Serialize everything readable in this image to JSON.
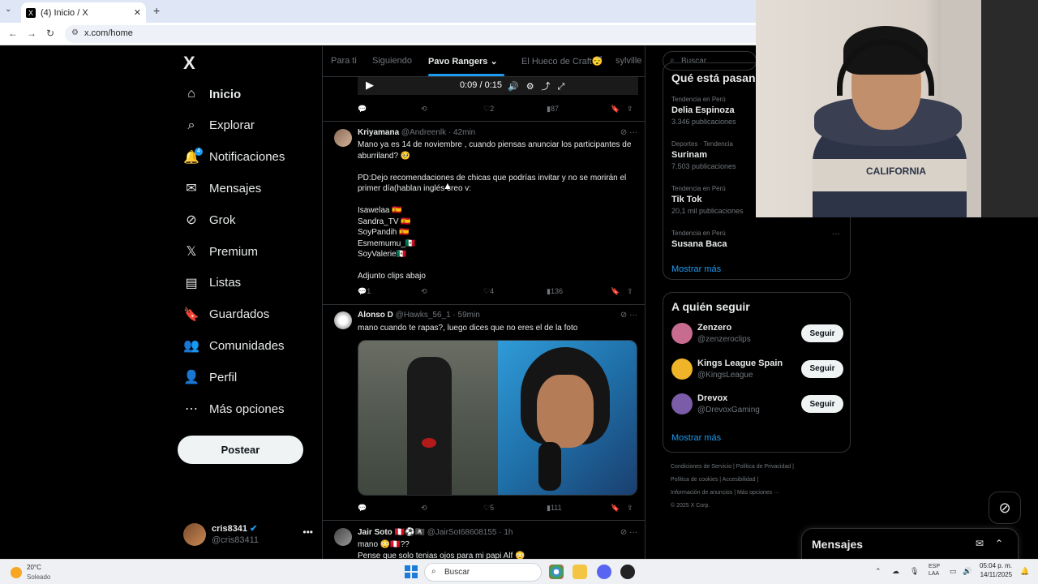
{
  "browser": {
    "tab_title": "(4) Inicio / X",
    "tab_favicon": "X",
    "url": "x.com/home"
  },
  "nav": {
    "logo": "X",
    "items": [
      {
        "label": "Inicio",
        "icon": "home-icon",
        "glyph": "⌂"
      },
      {
        "label": "Explorar",
        "icon": "search-icon",
        "glyph": "⌕"
      },
      {
        "label": "Notificaciones",
        "icon": "bell-icon",
        "glyph": "🔔",
        "badge": "4"
      },
      {
        "label": "Mensajes",
        "icon": "mail-icon",
        "glyph": "✉"
      },
      {
        "label": "Grok",
        "icon": "grok-icon",
        "glyph": "⊘"
      },
      {
        "label": "Premium",
        "icon": "x-premium-icon",
        "glyph": "𝕏"
      },
      {
        "label": "Listas",
        "icon": "list-icon",
        "glyph": "▤"
      },
      {
        "label": "Guardados",
        "icon": "bookmark-icon",
        "glyph": "🔖"
      },
      {
        "label": "Comunidades",
        "icon": "communities-icon",
        "glyph": "👥"
      },
      {
        "label": "Perfil",
        "icon": "profile-icon",
        "glyph": "👤"
      },
      {
        "label": "Más opciones",
        "icon": "more-circle-icon",
        "glyph": "⋯"
      }
    ],
    "post_button": "Postear",
    "account": {
      "name": "cris8341",
      "handle": "@cris83411",
      "more": "•••"
    }
  },
  "feed": {
    "tabs": [
      "Para ti",
      "Siguiendo",
      "Pavo Rangers",
      "El Hueco de Craft😴",
      "sylville"
    ],
    "active_tab": "Pavo Rangers",
    "video": {
      "time": "0:09 / 0:15"
    },
    "first_actions": {
      "replies": "",
      "reposts": "",
      "likes": "2",
      "views": "87"
    },
    "tweets": [
      {
        "name": "Kriyamana",
        "meta": "@Andreenlk · 42min",
        "lines": [
          "Mano ya es 14 de noviembre , cuando piensas anunciar los participantes de",
          "aburriland? 🥺",
          "",
          "PD:Dejo recomendaciones de chicas que podrías invitar y no se morirán el",
          "primer día(hablan inglés creo v:",
          "",
          "Isawelaa 🇪🇸",
          "Sandra_TV 🇪🇸",
          "SoyPandih 🇪🇸",
          "Esmemumu_🇲🇽",
          "SoyValerie🇲🇽",
          "",
          "Adjunto clips abajo"
        ],
        "replies": "1",
        "reposts": "",
        "likes": "4",
        "views": "136"
      },
      {
        "name": "Alonso D",
        "meta": "@Hawks_56_1 · 59min",
        "lines": [
          "mano cuando te rapas?, luego dices que no eres el de la foto"
        ],
        "replies": "",
        "reposts": "",
        "likes": "5",
        "views": "111"
      },
      {
        "name": "Jair Soto 🇵🇪⚽🏴‍☠️",
        "meta": "@JairSot68608155 · 1h",
        "lines": [
          "mano 😳🇵🇪??",
          "Pense que solo tenias ojos para mi papi Alf 😳"
        ]
      }
    ]
  },
  "right": {
    "search_placeholder": "Buscar",
    "trends_title": "Qué está pasando",
    "trends": [
      {
        "context": "Tendencia en Perú",
        "name": "Delia Espinoza",
        "count": "3.346 publicaciones"
      },
      {
        "context": "Deportes · Tendencia",
        "name": "Surinam",
        "count": "7.503 publicaciones"
      },
      {
        "context": "Tendencia en Perú",
        "name": "Tik Tok",
        "count": "20,1 mil publicaciones"
      },
      {
        "context": "Tendencia en Perú",
        "name": "Susana Baca",
        "count": ""
      }
    ],
    "show_more": "Mostrar más",
    "follow_title": "A quién seguir",
    "follow": [
      {
        "name": "Zenzero",
        "handle": "@zenzeroclips",
        "button": "Seguir",
        "color": "#c76b8f"
      },
      {
        "name": "Kings League Spain",
        "handle": "@KingsLeague",
        "button": "Seguir",
        "color": "#f0b429"
      },
      {
        "name": "Drevox",
        "handle": "@DrevoxGaming",
        "button": "Seguir",
        "color": "#7b5ca8"
      }
    ],
    "follow_more": "Mostrar más",
    "footer": [
      "Condiciones de Servicio  |  Política de Privacidad  |",
      "Política de cookies  |  Accesibilidad  |",
      "Información de anuncios  |  Más opciones ···",
      "© 2025 X Corp."
    ]
  },
  "messages_drawer": {
    "title": "Mensajes"
  },
  "webcam": {
    "shirt_text": "CALIFORNIA"
  },
  "taskbar": {
    "weather_temp": "20°C",
    "weather_desc": "Soleado",
    "search": "Buscar",
    "lang1": "ESP",
    "lang2": "LAA",
    "time": "05:04 p. m.",
    "date": "14/11/2025"
  },
  "colors": {
    "accent": "#1d9bf0",
    "background": "#000000"
  }
}
